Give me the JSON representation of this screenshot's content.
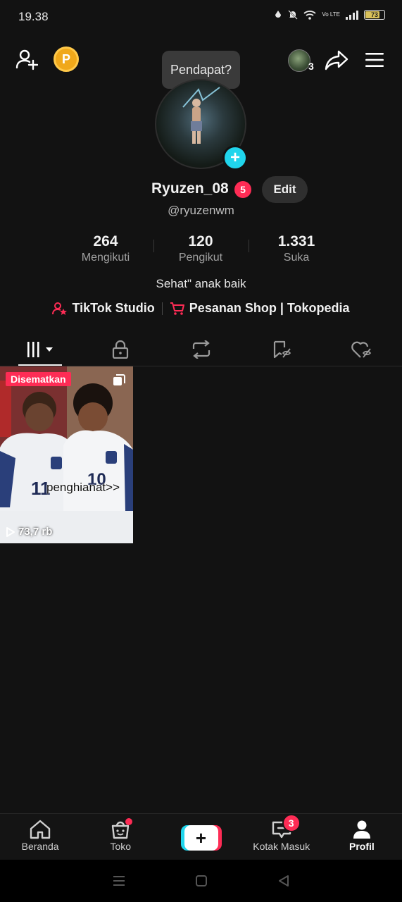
{
  "status_bar": {
    "time": "19.38",
    "network_label": "Vo LTE",
    "battery": "73"
  },
  "header": {
    "tooltip": "Pendapat?",
    "mini_avatar_count": "3",
    "coin_label": "P"
  },
  "profile": {
    "username": "Ryuzen_08",
    "name_badge": "5",
    "edit_label": "Edit",
    "handle": "@ryuzenwm",
    "bio": "Sehat\" anak baik",
    "stats": [
      {
        "value": "264",
        "label": "Mengikuti"
      },
      {
        "value": "120",
        "label": "Pengikut"
      },
      {
        "value": "1.331",
        "label": "Suka"
      }
    ],
    "links": [
      {
        "label": "TikTok Studio",
        "icon": "person-star-icon"
      },
      {
        "label": "Pesanan Shop | Tokopedia",
        "icon": "shopping-cart-icon"
      }
    ]
  },
  "tabs": [
    {
      "name": "videos",
      "icon": "grid-bars-icon",
      "active": true
    },
    {
      "name": "private",
      "icon": "lock-icon"
    },
    {
      "name": "reposts",
      "icon": "repost-icon"
    },
    {
      "name": "favorites",
      "icon": "bookmark-icon"
    },
    {
      "name": "liked",
      "icon": "heart-icon"
    }
  ],
  "videos": [
    {
      "pinned_label": "Disematkan",
      "overlay_text": "penghianat>>",
      "views": "73,7 rb"
    }
  ],
  "bottom_nav": {
    "items": [
      {
        "label": "Beranda",
        "icon": "home-icon"
      },
      {
        "label": "Toko",
        "icon": "shop-bag-icon"
      },
      {
        "label": "",
        "icon": "create-plus-icon"
      },
      {
        "label": "Kotak Masuk",
        "icon": "inbox-icon",
        "badge": "3"
      },
      {
        "label": "Profil",
        "icon": "profile-icon",
        "active": true
      }
    ]
  },
  "colors": {
    "background": "#121212",
    "accent_red": "#fe2c55",
    "accent_cyan": "#20d5ec"
  }
}
